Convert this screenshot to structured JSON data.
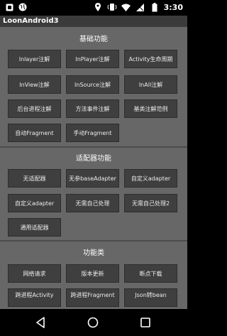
{
  "status_bar": {
    "time": "3:30",
    "icons": [
      "notification-box-icon",
      "globe-icon",
      "location-icon",
      "vibrate-icon",
      "wifi-icon",
      "signal-icon",
      "battery-icon"
    ]
  },
  "app": {
    "title": "LoonAndroid3"
  },
  "sections": [
    {
      "title": "基础功能",
      "buttons": [
        "Inlayer注解",
        "InPlayer注解",
        "Activity生命周期",
        "InView注解",
        "InSource注解",
        "InAll注解",
        "后台进程注解",
        "方法事件注解",
        "基类注解范例",
        "自动Fragment",
        "手动Fragment"
      ]
    },
    {
      "title": "适配器功能",
      "buttons": [
        "无适配器",
        "无参baseAdapter",
        "自定义adapter",
        "自定义adapter",
        "无需自己处理",
        "无需自己处理2",
        "通用适配器"
      ]
    },
    {
      "title": "功能类",
      "buttons": [
        "网络请求",
        "版本更新",
        "断点下载",
        "跨进程Activity",
        "跨进程Fragment",
        "Json转bean"
      ]
    }
  ],
  "nav": {
    "icons": [
      "back-icon",
      "home-icon",
      "recents-icon"
    ]
  }
}
